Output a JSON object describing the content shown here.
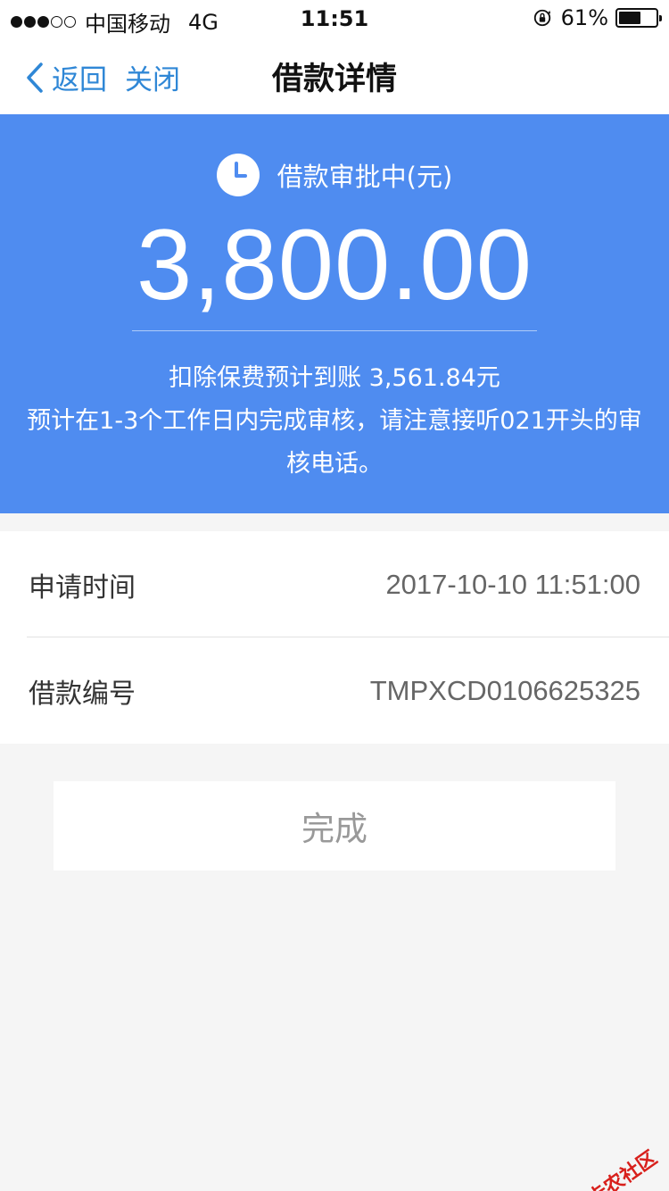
{
  "status_bar": {
    "carrier": "中国移动",
    "network": "4G",
    "time": "11:51",
    "battery": "61%",
    "battery_level": 0.61,
    "signal_bars": 3,
    "signal_total": 5
  },
  "nav": {
    "back_label": "返回",
    "close_label": "关闭",
    "title": "借款详情"
  },
  "hero": {
    "status": "借款审批中(元)",
    "amount": "3,800.00",
    "note_line1": "扣除保费预计到账 3,561.84元",
    "note_line2": "预计在1-3个工作日内完成审核，请注意接听021开头的审核电话。",
    "background_color": "#4f8cf0"
  },
  "details": [
    {
      "label": "申请时间",
      "value": "2017-10-10 11:51:00"
    },
    {
      "label": "借款编号",
      "value": "TMPXCD0106625325"
    }
  ],
  "done_button": "完成",
  "watermark": "卡农社区",
  "icons": {
    "back": "chevron-left-icon",
    "clock": "clock-icon",
    "lock_rotation": "rotation-lock-icon",
    "battery": "battery-icon"
  },
  "accent_color": "#2f87d6"
}
